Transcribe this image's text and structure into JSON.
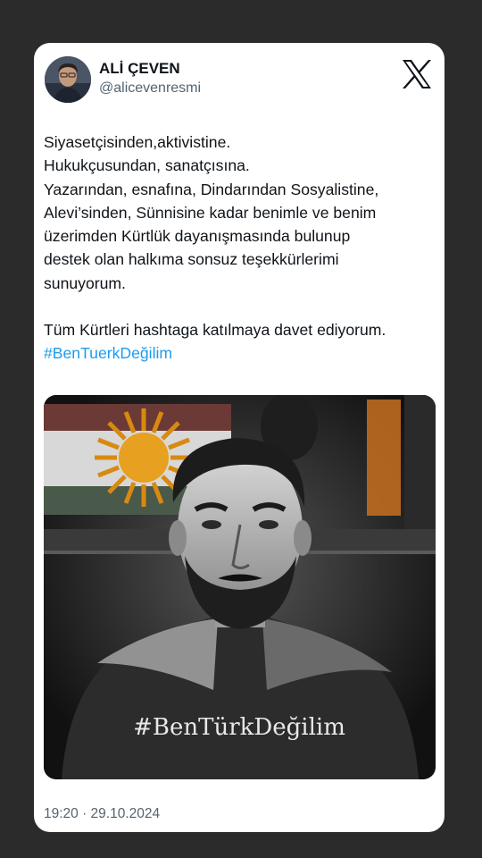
{
  "author": {
    "display_name": "ALİ ÇEVEN",
    "handle": "@alicevenresmi"
  },
  "brand_icon": "x-logo-icon",
  "tweet": {
    "lines": [
      "Siyasetçisinden,aktivistine.",
      "Hukukçusundan, sanatçısına.",
      "Yazarından, esnafına, Dindarından Sosyalistine,",
      "Alevi’sinden, Sünnisine kadar benimle ve benim",
      "üzerimden Kürtlük dayanışmasında bulunup",
      "destek olan halkıma sonsuz teşekkürlerimi",
      "sunuyorum."
    ],
    "invite": "Tüm Kürtleri hashtaga katılmaya davet ediyorum.",
    "hashtag": "#BenTuerkDeğilim"
  },
  "media": {
    "overlay_text": "#BenTürkDeğilim"
  },
  "timestamp": "19:20 · 29.10.2024",
  "colors": {
    "background": "#2b2b2b",
    "card": "#ffffff",
    "text": "#0f1419",
    "secondary": "#536471",
    "link": "#1d9bf0"
  }
}
